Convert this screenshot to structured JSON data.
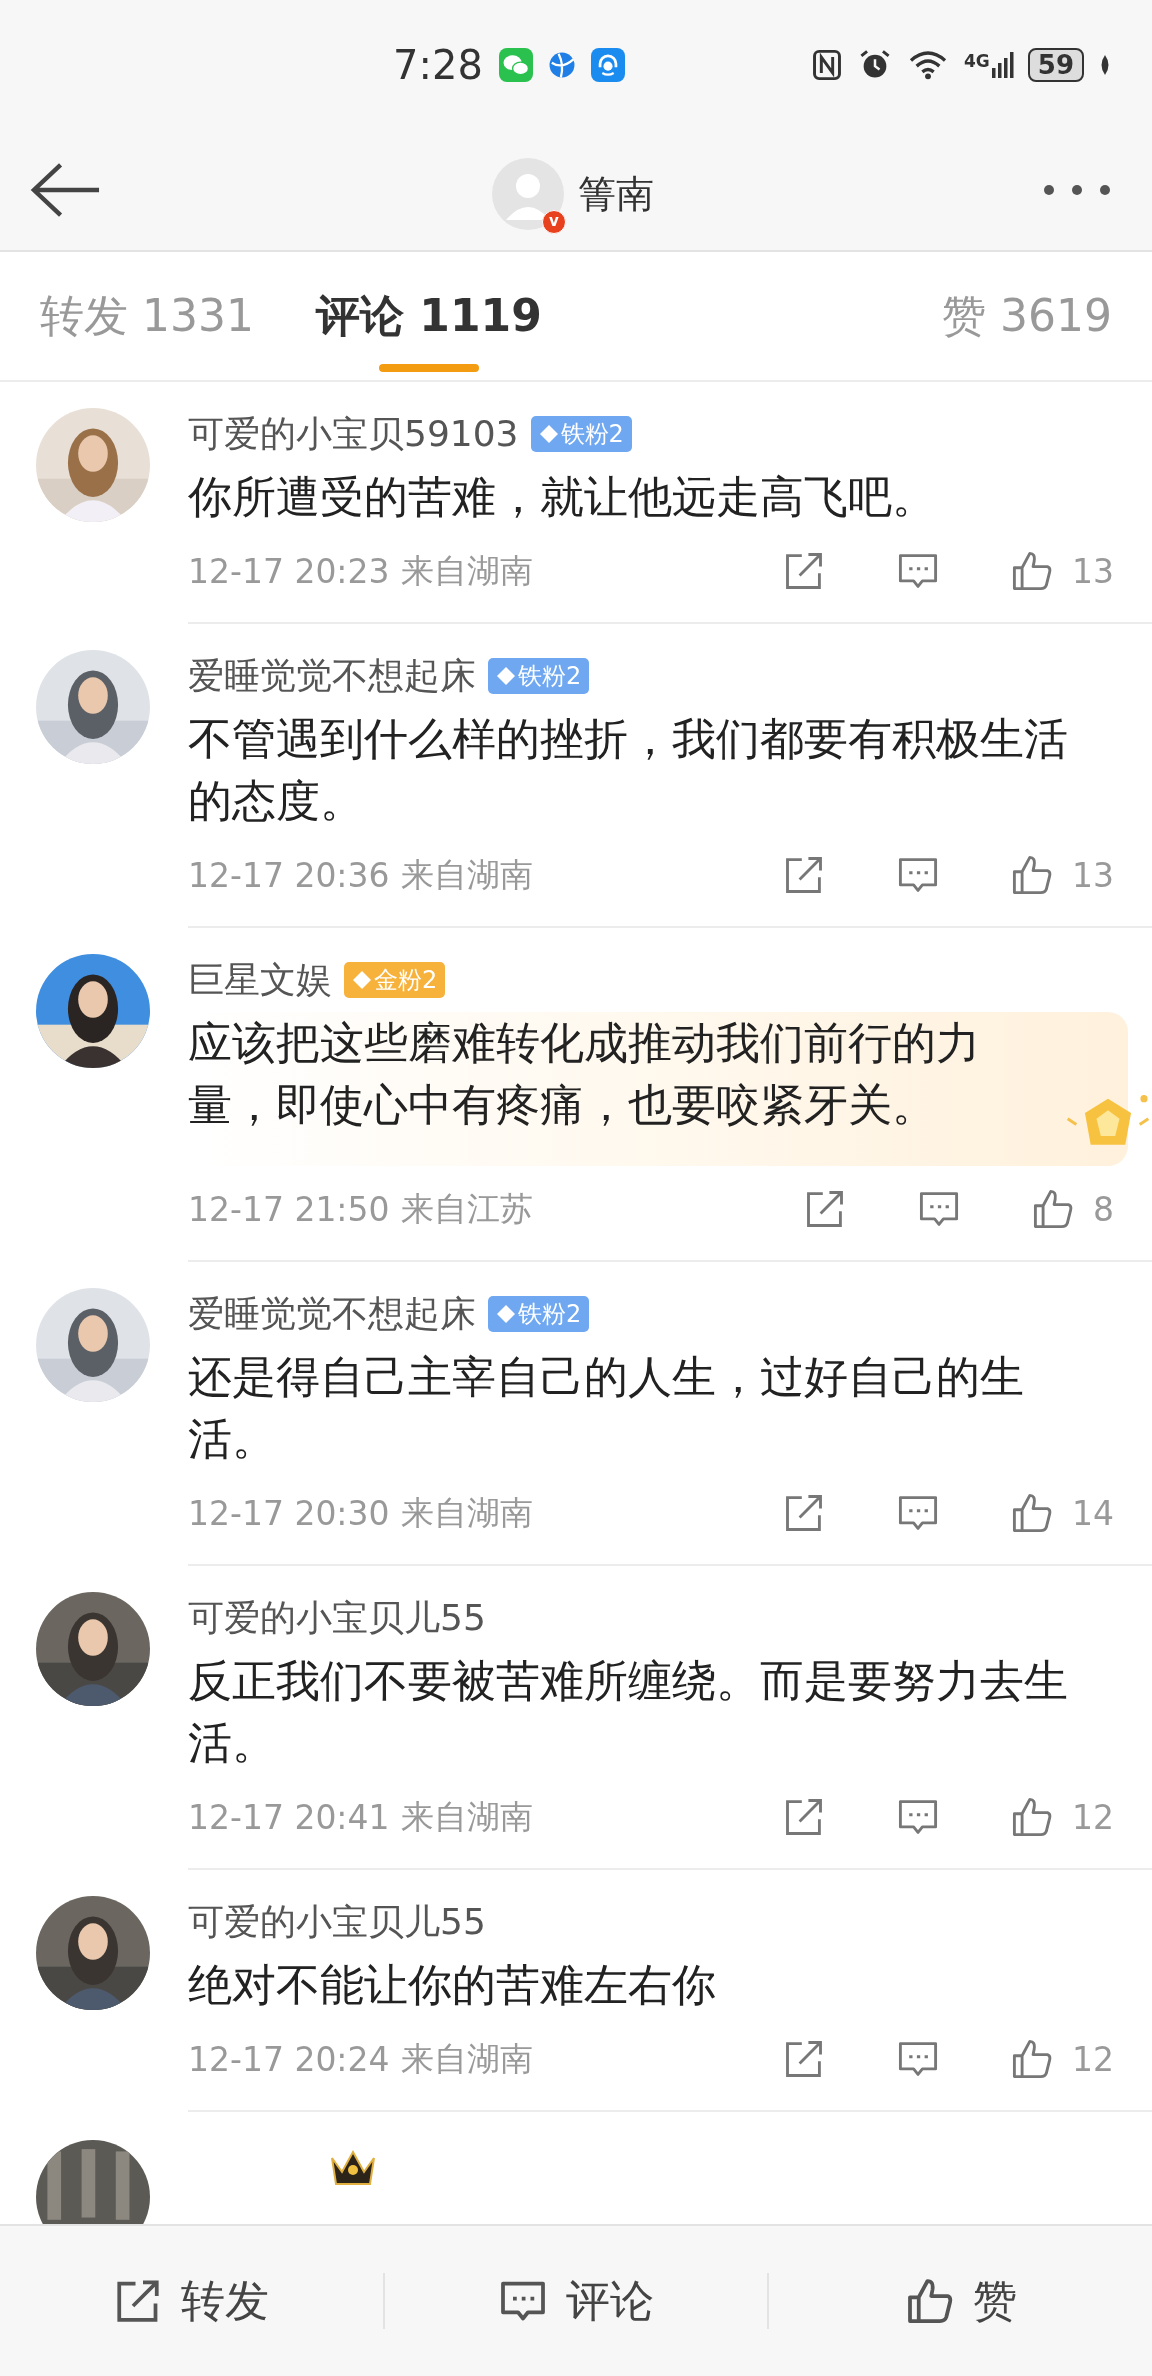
{
  "status_bar": {
    "time": "7:28",
    "network": "4G",
    "battery": "59"
  },
  "header": {
    "user_name": "箐南",
    "verified_mark": "v"
  },
  "tabs": [
    {
      "label": "转发 1331",
      "selected": false
    },
    {
      "label": "评论 1119",
      "selected": true
    },
    {
      "label": "赞 3619",
      "selected": false
    }
  ],
  "comments": [
    {
      "user_name": "可爱的小宝贝59103",
      "badge": {
        "label": "铁粉2",
        "color": "#6fa8f0"
      },
      "text": "你所遭受的苦难，就让他远走高飞吧。",
      "time": "12-17 20:23",
      "location": "来自湖南",
      "likes": "13",
      "decorated": false
    },
    {
      "user_name": "爱睡觉觉不想起床",
      "badge": {
        "label": "铁粉2",
        "color": "#6fa8f0"
      },
      "text": "不管遇到什么样的挫折，我们都要有积极生活的态度。",
      "time": "12-17 20:36",
      "location": "来自湖南",
      "likes": "13",
      "decorated": false
    },
    {
      "user_name": "巨星文娱",
      "badge": {
        "label": "金粉2",
        "color": "#f7b23b"
      },
      "text": "应该把这些磨难转化成推动我们前行的力量，即使心中有疼痛，也要咬紧牙关。",
      "time": "12-17 21:50",
      "location": "来自江苏",
      "likes": "8",
      "decorated": true
    },
    {
      "user_name": "爱睡觉觉不想起床",
      "badge": {
        "label": "铁粉2",
        "color": "#6fa8f0"
      },
      "text": "还是得自己主宰自己的人生，过好自己的生活。",
      "time": "12-17 20:30",
      "location": "来自湖南",
      "likes": "14",
      "decorated": false
    },
    {
      "user_name": "可爱的小宝贝儿55",
      "text": "反正我们不要被苦难所缠绕。而是要努力去生活。",
      "time": "12-17 20:41",
      "location": "来自湖南",
      "likes": "12",
      "decorated": false
    },
    {
      "user_name": "可爱的小宝贝儿55",
      "text": "绝对不能让你的苦难左右你",
      "time": "12-17 20:24",
      "location": "来自湖南",
      "likes": "12",
      "decorated": false
    }
  ],
  "partial_comment": {
    "crown": true
  },
  "bottom_bar": [
    {
      "kind": "share",
      "label": "转发"
    },
    {
      "kind": "comment",
      "label": "评论"
    },
    {
      "kind": "like",
      "label": "赞"
    }
  ]
}
